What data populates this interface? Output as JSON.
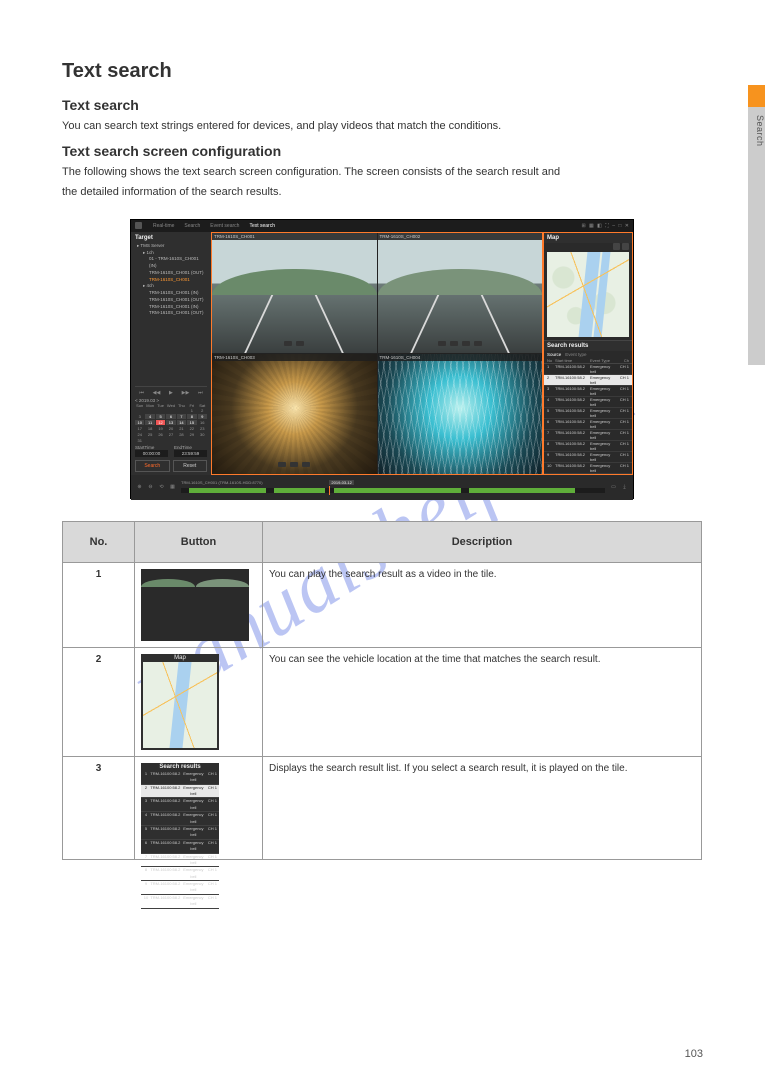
{
  "sideTab": {
    "label": "Search"
  },
  "section": {
    "heading": "Text search",
    "sub1": "Text search",
    "p1": "You can search text strings entered for devices, and play videos that match the conditions.",
    "sub2": "Text search screen configuration",
    "p2": "The following shows the text search screen configuration. The screen consists of the search result and",
    "p3": "the detailed information of the search results."
  },
  "shot": {
    "tabs": [
      "Real-time",
      "Search",
      "Event search",
      "Text search"
    ],
    "activeTab": 3,
    "leftTitle": "Target",
    "tree": [
      {
        "lvl": 1,
        "t": "▸ TMS Server"
      },
      {
        "lvl": 2,
        "t": "▸ 1ch"
      },
      {
        "lvl": 3,
        "t": "01 - TRM-1610S_CH001 (IN)"
      },
      {
        "lvl": 3,
        "t": "TRM-1610S_CH001 (OUT)"
      },
      {
        "lvl": 3,
        "t": "TRM-1610S_CH001",
        "sel": true
      },
      {
        "lvl": 2,
        "t": "▸ 4ch"
      },
      {
        "lvl": 3,
        "t": "TRM-1610S_CH001 (IN)"
      },
      {
        "lvl": 3,
        "t": "TRM-1610S_CH001 (OUT)"
      },
      {
        "lvl": 3,
        "t": "TRM-1610S_CH001 (IN)"
      },
      {
        "lvl": 3,
        "t": "TRM-1610S_CH001 (OUT)"
      }
    ],
    "calMonth": "< 2019.03 >",
    "calDow": [
      "Sun",
      "Mon",
      "Tue",
      "Wed",
      "Thu",
      "Fri",
      "Sat"
    ],
    "startLabel": "StartTime",
    "endLabel": "EndTime",
    "startVal": "00:00:00",
    "endVal": "23:59:59",
    "searchBtn": "Search",
    "resetBtn": "Reset",
    "camCaptions": [
      "TRM-1610S_CH001",
      "TRM-1610S_CH002",
      "TRM-1610S_CH003",
      "TRM-1610S_CH004"
    ],
    "mapTitle": "Map",
    "srTitle": "Search results",
    "srTabs": [
      "Source",
      "Event type"
    ],
    "srHead": [
      "No",
      "Start time",
      "Event Type",
      "Ch"
    ],
    "srRows": [
      [
        "1",
        "TRM-16100:58.2",
        "Emergency bell",
        "CH 1"
      ],
      [
        "2",
        "TRM-16100:58.2",
        "Emergency bell",
        "CH 1"
      ],
      [
        "3",
        "TRM-16100:58.2",
        "Emergency bell",
        "CH 1"
      ],
      [
        "4",
        "TRM-16100:58.2",
        "Emergency bell",
        "CH 1"
      ],
      [
        "5",
        "TRM-16100:58.2",
        "Emergency bell",
        "CH 1"
      ],
      [
        "6",
        "TRM-16100:58.2",
        "Emergency bell",
        "CH 1"
      ],
      [
        "7",
        "TRM-16100:58.2",
        "Emergency bell",
        "CH 1"
      ],
      [
        "8",
        "TRM-16100:58.2",
        "Emergency bell",
        "CH 1"
      ],
      [
        "9",
        "TRM-16100:58.2",
        "Emergency bell",
        "CH 1"
      ],
      [
        "10",
        "TRM-16100:58.2",
        "Emergency bell",
        "CH 1"
      ]
    ],
    "tlLabel": "TRM-1610S_CH001 (TRM-1610S-HDD:8770)",
    "tlDate": "2019-03-12"
  },
  "table": {
    "headers": [
      "No.",
      "Button",
      "Description"
    ],
    "rows": [
      {
        "no": "1",
        "desc": "You can play the search result as a video in the tile."
      },
      {
        "no": "2",
        "desc": "You can see the vehicle location at the time that matches the search result."
      },
      {
        "no": "3",
        "desc": "Displays the search result list. If you select a search result, it is played on the tile."
      }
    ]
  },
  "watermark": "manualshelf.com",
  "pageNumber": "103"
}
